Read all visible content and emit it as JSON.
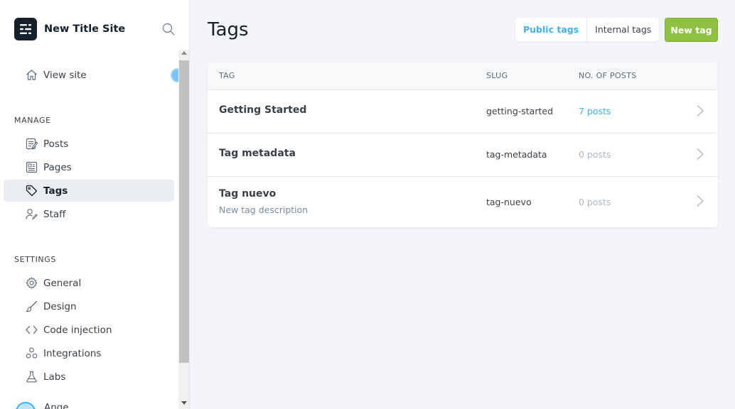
{
  "sidebar": {
    "site_title": "New Title Site",
    "view_site": "View site",
    "manage_heading": "MANAGE",
    "manage_items": [
      {
        "label": "Posts",
        "icon": "posts-icon"
      },
      {
        "label": "Pages",
        "icon": "pages-icon"
      },
      {
        "label": "Tags",
        "icon": "tag-icon",
        "active": true
      },
      {
        "label": "Staff",
        "icon": "staff-icon"
      }
    ],
    "settings_heading": "SETTINGS",
    "settings_items": [
      {
        "label": "General",
        "icon": "gear-icon"
      },
      {
        "label": "Design",
        "icon": "brush-icon"
      },
      {
        "label": "Code injection",
        "icon": "code-icon"
      },
      {
        "label": "Integrations",
        "icon": "integrations-icon"
      },
      {
        "label": "Labs",
        "icon": "flask-icon"
      }
    ],
    "user_name": "Ange"
  },
  "header": {
    "title": "Tags",
    "public_tags": "Public tags",
    "internal_tags": "Internal tags",
    "new_tag": "New tag"
  },
  "table": {
    "columns": [
      "TAG",
      "SLUG",
      "NO. OF POSTS"
    ],
    "rows": [
      {
        "name": "Getting Started",
        "description": "",
        "slug": "getting-started",
        "posts": "7 posts"
      },
      {
        "name": "Tag metadata",
        "description": "",
        "slug": "tag-metadata",
        "posts": "0 posts"
      },
      {
        "name": "Tag nuevo",
        "description": "New tag description",
        "slug": "tag-nuevo",
        "posts": "0 posts"
      }
    ]
  },
  "colors": {
    "accent_blue": "#3eb0ef",
    "new_tag_green": "#8fc03f",
    "sidebar_active_bg": "#e9ecf1"
  }
}
